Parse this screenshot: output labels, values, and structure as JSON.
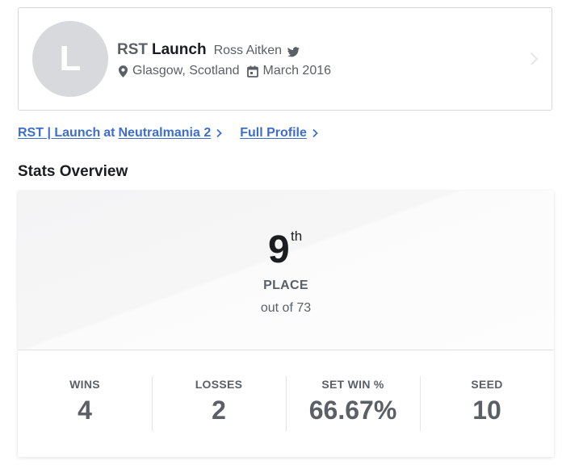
{
  "profile": {
    "avatar_initial": "L",
    "prefix": "RST",
    "gamertag": "Launch",
    "real_name": "Ross Aitken",
    "location": "Glasgow, Scotland",
    "joined": "March 2016",
    "icons": [
      "twitter-icon",
      "map-pin-icon",
      "calendar-icon",
      "chevron-right-icon"
    ]
  },
  "links": {
    "player_tag": "RST | Launch",
    "at_word": "at",
    "tournament": "Neutralmania 2",
    "full_profile": "Full Profile"
  },
  "section_title": "Stats Overview",
  "placement": {
    "number": "9",
    "suffix": "th",
    "label": "PLACE",
    "total": "out of 73"
  },
  "stats": [
    {
      "label": "WINS",
      "value": "4"
    },
    {
      "label": "LOSSES",
      "value": "2"
    },
    {
      "label": "SET WIN %",
      "value": "66.67%"
    },
    {
      "label": "SEED",
      "value": "10"
    }
  ],
  "colors": {
    "link": "#3d6ecf",
    "text_dark": "#1b1d21",
    "text_muted": "#5b5f66",
    "avatar_bg": "#d7d9dc"
  }
}
